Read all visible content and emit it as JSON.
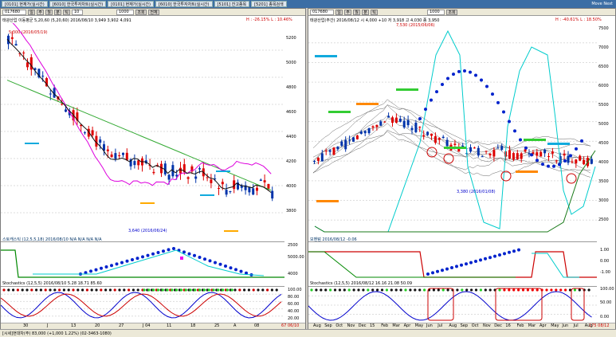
{
  "taskbar": {
    "tabs": [
      "[0101] 현재가(실시간)",
      "[6010] 한국투자차트(실시간)",
      "[0101] 현재가(실시간)",
      "[6010] 한국투자차트(실시간)",
      "[5101] 잔고종목",
      "[5201] 종목검색"
    ],
    "right": "Move Next"
  },
  "left_chart": {
    "toolbar": {
      "code": "017680",
      "period": "10",
      "count": "1000",
      "buttons": [
        "일",
        "주",
        "월",
        "분",
        "틱",
        "조회",
        "전체"
      ]
    },
    "title": "태광산업 이동평균 5,20,60 (5,20,60) 2016/08/10 3,949 3,902 4,091",
    "hl": "H : -26.15%  L : 10.46%",
    "high_note": "5,300 (2016/05/19)",
    "low_note": "3,640 (2016/06/24)",
    "y_ticks": [
      "5200",
      "5000",
      "4800",
      "4600",
      "4400",
      "4200",
      "4000",
      "3800"
    ],
    "x_ticks": [
      "30",
      "J",
      "13",
      "20",
      "27",
      "J 04",
      "11",
      "18",
      "25",
      "A",
      "08"
    ],
    "stoch_title": "스토캐스틱 (12,5,5,18) 2016/08/10 N/A N/A N/A N/A",
    "stoch_ticks": [
      "2500",
      "5000.00",
      "4000"
    ],
    "stochastics_title": "Stochastics (12,5,5) 2016/08/10 5.28 18.71 85.60",
    "sto_ticks": [
      "100.00",
      "80.00",
      "60.00",
      "40.00",
      "20.00"
    ],
    "footer": "67  06/10"
  },
  "right_chart": {
    "toolbar": {
      "code": "017680",
      "count": "1000",
      "buttons": [
        "일",
        "주",
        "월",
        "분",
        "틱",
        "조회"
      ]
    },
    "title": "태광산업(주간) 2016/08/12  시 4,000  +10  저 3,918  고 4,030  종 3,950",
    "hl": "H : -40.61%  L : 18.50%",
    "high_note": "7,530 (2015/06/06)",
    "low_note": "3,380 (2016/01/08)",
    "y_ticks": [
      "7500",
      "7000",
      "6500",
      "6000",
      "5500",
      "5000",
      "4500",
      "4000",
      "3500",
      "3000",
      "2500"
    ],
    "x_ticks": [
      "Aug",
      "Sep",
      "Oct",
      "Nov",
      "Dec",
      "15",
      "Feb",
      "Mar",
      "Apr",
      "May",
      "Jun",
      "Jul",
      "Aug",
      "Sep",
      "Oct",
      "Nov",
      "Dec",
      "16",
      "Feb",
      "Mar",
      "Apr",
      "May",
      "Jun",
      "Jul",
      "Aug"
    ],
    "stoch_title": "모멘텀 2016/08/12 -0.06",
    "stoch_ticks": [
      "1.00",
      "0.00",
      "-1.00"
    ],
    "stochastics_title": "Stochastics (12,5,5) 2016/08/12 16.16 21.08 50.09",
    "sto_ticks": [
      "100.00",
      "50.00",
      "0.00"
    ],
    "footer": "175  08/12"
  },
  "status": "[시세]현대차(주) 83,000 (+1,000 1.22%)  (02-3463-1080)"
}
